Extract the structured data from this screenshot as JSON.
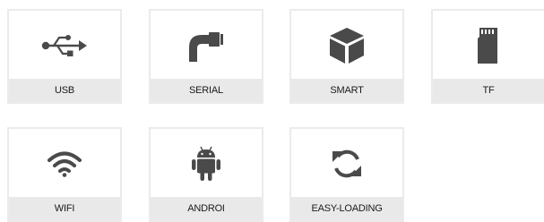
{
  "accent_color": "#4a4a4a",
  "tiles": [
    {
      "label": "USB",
      "icon": "usb-icon"
    },
    {
      "label": "SERIAL",
      "icon": "serial-plug-icon"
    },
    {
      "label": "SMART",
      "icon": "cube-icon"
    },
    {
      "label": "TF",
      "icon": "sd-card-icon"
    },
    {
      "label": "WIFI",
      "icon": "wifi-icon"
    },
    {
      "label": "ANDROI",
      "icon": "android-icon"
    },
    {
      "label": "EASY-LOADING",
      "icon": "refresh-icon"
    }
  ]
}
